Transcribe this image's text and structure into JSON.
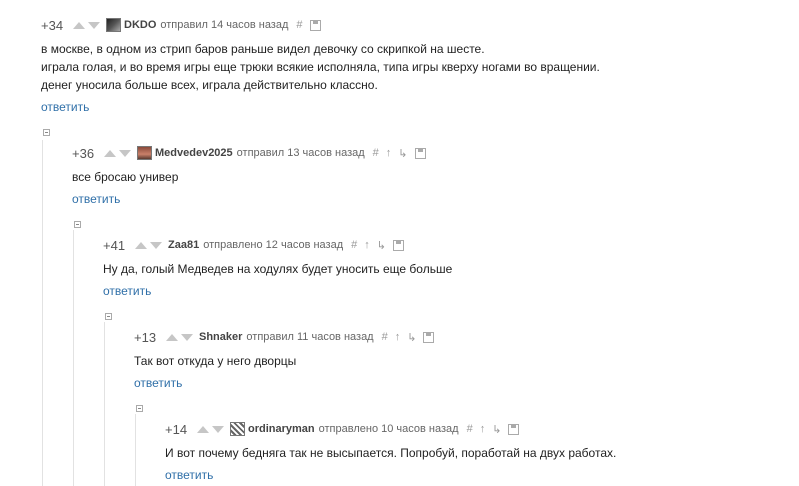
{
  "comments": [
    {
      "rating": "+34",
      "author": "DKDO",
      "meta": "отправил 14 часов назад",
      "body": [
        "в москве, в одном из стрип баров раньше видел девочку со скрипкой на шесте.",
        "играла голая, и во время игры еще трюки всякие исполняла, типа игры кверху ногами во вращении.",
        "денег уносила больше всех, играла действительно классно."
      ],
      "reply": "ответить",
      "actions": {
        "hash": "#",
        "up": "",
        "branch": ""
      }
    },
    {
      "rating": "+36",
      "author": "Medvedev2025",
      "meta": "отправил 13 часов назад",
      "body": [
        "все бросаю универ"
      ],
      "reply": "ответить",
      "actions": {
        "hash": "#",
        "up": "↑",
        "branch": "↳"
      }
    },
    {
      "rating": "+41",
      "author": "Zaa81",
      "meta": "отправлено 12 часов назад",
      "body": [
        "Ну да, голый Медведев на ходулях будет уносить еще больше"
      ],
      "reply": "ответить",
      "actions": {
        "hash": "#",
        "up": "↑",
        "branch": "↳"
      }
    },
    {
      "rating": "+13",
      "author": "Shnaker",
      "meta": "отправил 11 часов назад",
      "body": [
        "Так вот откуда у него дворцы"
      ],
      "reply": "ответить",
      "actions": {
        "hash": "#",
        "up": "↑",
        "branch": "↳"
      }
    },
    {
      "rating": "+14",
      "author": "ordinaryman",
      "meta": "отправлено 10 часов назад",
      "body": [
        "И вот почему бедняга так не высыпается. Попробуй, поработай на двух работах."
      ],
      "reply": "ответить",
      "actions": {
        "hash": "#",
        "up": "↑",
        "branch": "↳"
      }
    }
  ],
  "colors": {
    "link": "#2f6fa8",
    "text": "#222222",
    "meta": "#666666",
    "votes": "#c6c6c6"
  },
  "icons": {
    "avatar_0": "dark-avatar",
    "avatar_1": "photo-avatar",
    "avatar_4": "robot-avatar"
  }
}
